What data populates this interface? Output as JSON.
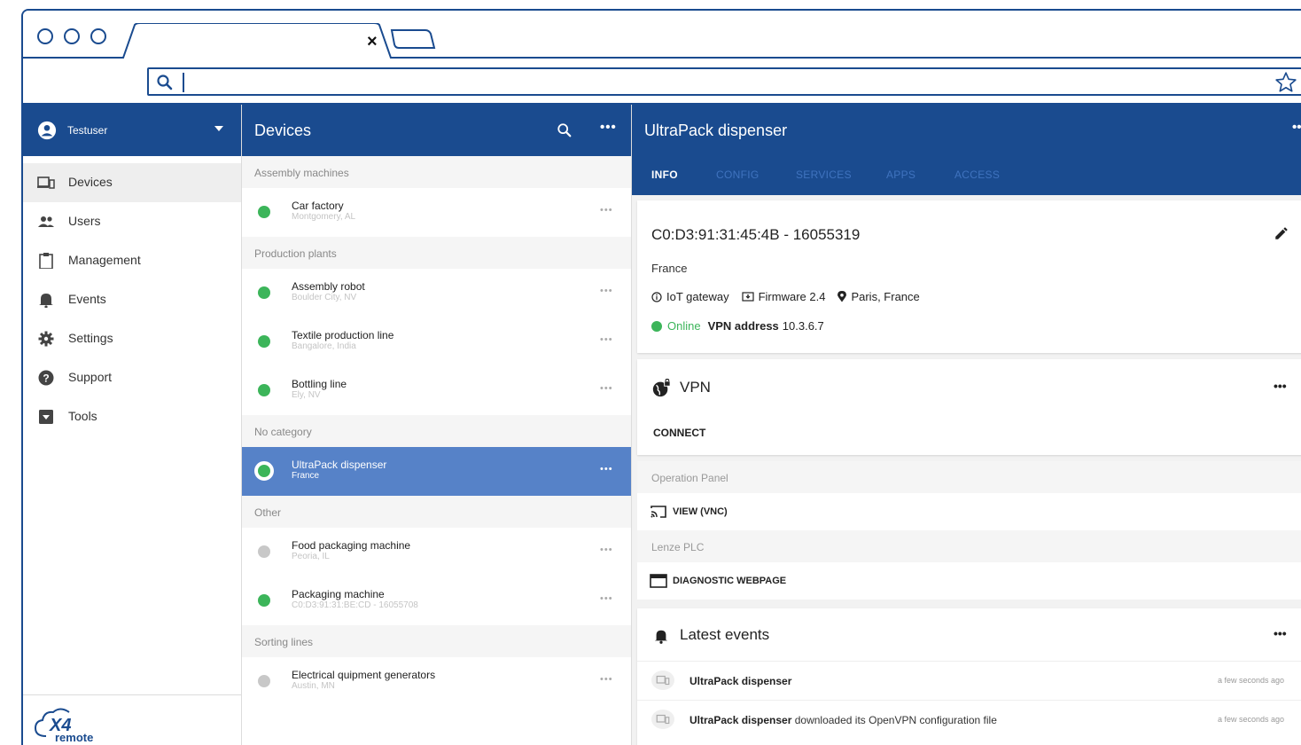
{
  "browser": {
    "tab_close": "×"
  },
  "sidebar": {
    "user": "Testuser",
    "items": [
      {
        "label": "Devices",
        "icon": "devices-icon"
      },
      {
        "label": "Users",
        "icon": "users-icon"
      },
      {
        "label": "Management",
        "icon": "clipboard-icon"
      },
      {
        "label": "Events",
        "icon": "bell-icon"
      },
      {
        "label": "Settings",
        "icon": "gear-icon"
      },
      {
        "label": "Support",
        "icon": "help-icon"
      },
      {
        "label": "Tools",
        "icon": "toolbox-icon"
      }
    ],
    "logo_big": "X4",
    "logo_small": "remote"
  },
  "devices": {
    "title": "Devices",
    "more": "•••",
    "groups": [
      {
        "category": "Assembly machines",
        "items": [
          {
            "name": "Car factory",
            "sub": "Montgomery, AL",
            "status": "online"
          }
        ]
      },
      {
        "category": "Production plants",
        "items": [
          {
            "name": "Assembly robot",
            "sub": "Boulder City, NV",
            "status": "online"
          },
          {
            "name": "Textile production line",
            "sub": "Bangalore, India",
            "status": "online"
          },
          {
            "name": "Bottling line",
            "sub": "Ely, NV",
            "status": "online"
          }
        ]
      },
      {
        "category": "No category",
        "items": [
          {
            "name": "UltraPack dispenser",
            "sub": "France",
            "status": "online",
            "selected": true
          }
        ]
      },
      {
        "category": "Other",
        "items": [
          {
            "name": "Food packaging machine",
            "sub": "Peoria, IL",
            "status": "offline"
          },
          {
            "name": "Packaging machine",
            "sub": "C0:D3:91:31:BE:CD - 16055708",
            "status": "online"
          }
        ]
      },
      {
        "category": "Sorting lines",
        "items": [
          {
            "name": "Electrical quipment generators",
            "sub": "Austin, MN",
            "status": "offline"
          }
        ]
      }
    ],
    "item_more": "•••"
  },
  "detail": {
    "title": "UltraPack dispenser",
    "more": "•••",
    "tabs": [
      "INFO",
      "CONFIG",
      "SERVICES",
      "APPS",
      "ACCESS"
    ],
    "info": {
      "heading": "C0:D3:91:31:45:4B - 16055319",
      "country": "France",
      "type": "IoT gateway",
      "firmware": "Firmware 2.4",
      "location": "Paris, France",
      "status": "Online",
      "vpn_label": "VPN address",
      "vpn_value": "10.3.6.7"
    },
    "vpn": {
      "title": "VPN",
      "connect": "CONNECT",
      "more": "•••"
    },
    "sections": [
      {
        "title": "Operation Panel",
        "action": "VIEW (VNC)",
        "icon": "cast-icon"
      },
      {
        "title": "Lenze PLC",
        "action": "DIAGNOSTIC WEBPAGE",
        "icon": "web-icon"
      }
    ],
    "events": {
      "title": "Latest events",
      "more": "•••",
      "rows": [
        {
          "device": "UltraPack dispenser",
          "text": "",
          "time": "a few seconds ago"
        },
        {
          "device": "UltraPack dispenser",
          "text": " downloaded its OpenVPN configuration file",
          "time": "a few seconds ago"
        }
      ]
    }
  },
  "colors": {
    "primary": "#1a4b8f",
    "selected": "#5682c8",
    "online": "#3cb55a",
    "offline": "#c8c8c8"
  }
}
